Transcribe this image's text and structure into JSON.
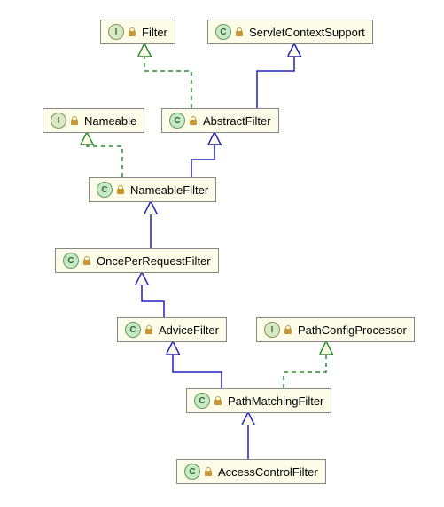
{
  "nodes": {
    "filter": {
      "label": "Filter",
      "kind": "I"
    },
    "servletContextSupport": {
      "label": "ServletContextSupport",
      "kind": "C"
    },
    "nameable": {
      "label": "Nameable",
      "kind": "I"
    },
    "abstractFilter": {
      "label": "AbstractFilter",
      "kind": "C"
    },
    "nameableFilter": {
      "label": "NameableFilter",
      "kind": "C"
    },
    "oncePerRequestFilter": {
      "label": "OncePerRequestFilter",
      "kind": "C"
    },
    "adviceFilter": {
      "label": "AdviceFilter",
      "kind": "C"
    },
    "pathConfigProcessor": {
      "label": "PathConfigProcessor",
      "kind": "I"
    },
    "pathMatchingFilter": {
      "label": "PathMatchingFilter",
      "kind": "C"
    },
    "accessControlFilter": {
      "label": "AccessControlFilter",
      "kind": "C"
    }
  }
}
